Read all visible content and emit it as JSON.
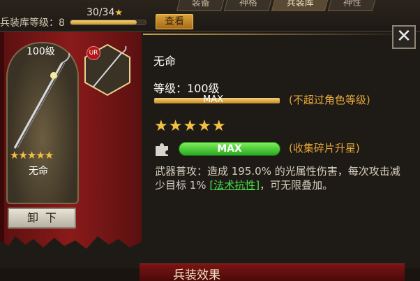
{
  "topbar": {
    "armory_label": "兵装库等级：8",
    "armory_count": "30/34",
    "armory_progress": 0.88,
    "view_button": "查看",
    "tabs": [
      "装备",
      "神格",
      "兵装库",
      "神性"
    ]
  },
  "weapon": {
    "card_level": "100级",
    "card_stars": "★★★★★",
    "card_name": "无命",
    "rarity_badge": "UR",
    "unequip_label": "卸下",
    "name": "无命",
    "level_text": "等级：100级",
    "level_bar_text": "MAX",
    "level_progress": 1.0,
    "level_note": "(不超过角色等级)",
    "stars": "★★★★★",
    "star_bar_text": "MAX",
    "star_progress": 1.0,
    "star_note": "(收集碎片升星)",
    "desc_part1": "武器普攻：造成 195.0% 的光属性伤害，每次攻击减少目标 1% ",
    "desc_link": "[法术抗性]",
    "desc_part2": "，可无限叠加。"
  },
  "effect": {
    "title": "兵装效果"
  },
  "colors": {
    "gold": "#f1c143",
    "orange_note": "#e8a93a",
    "banner_red": "#8a1a1a",
    "green_bar": "#2aa822",
    "link_green": "#45e045"
  },
  "icons": {
    "close": "close-icon",
    "puzzle": "puzzle-piece-icon",
    "weapon": "spear-icon"
  }
}
